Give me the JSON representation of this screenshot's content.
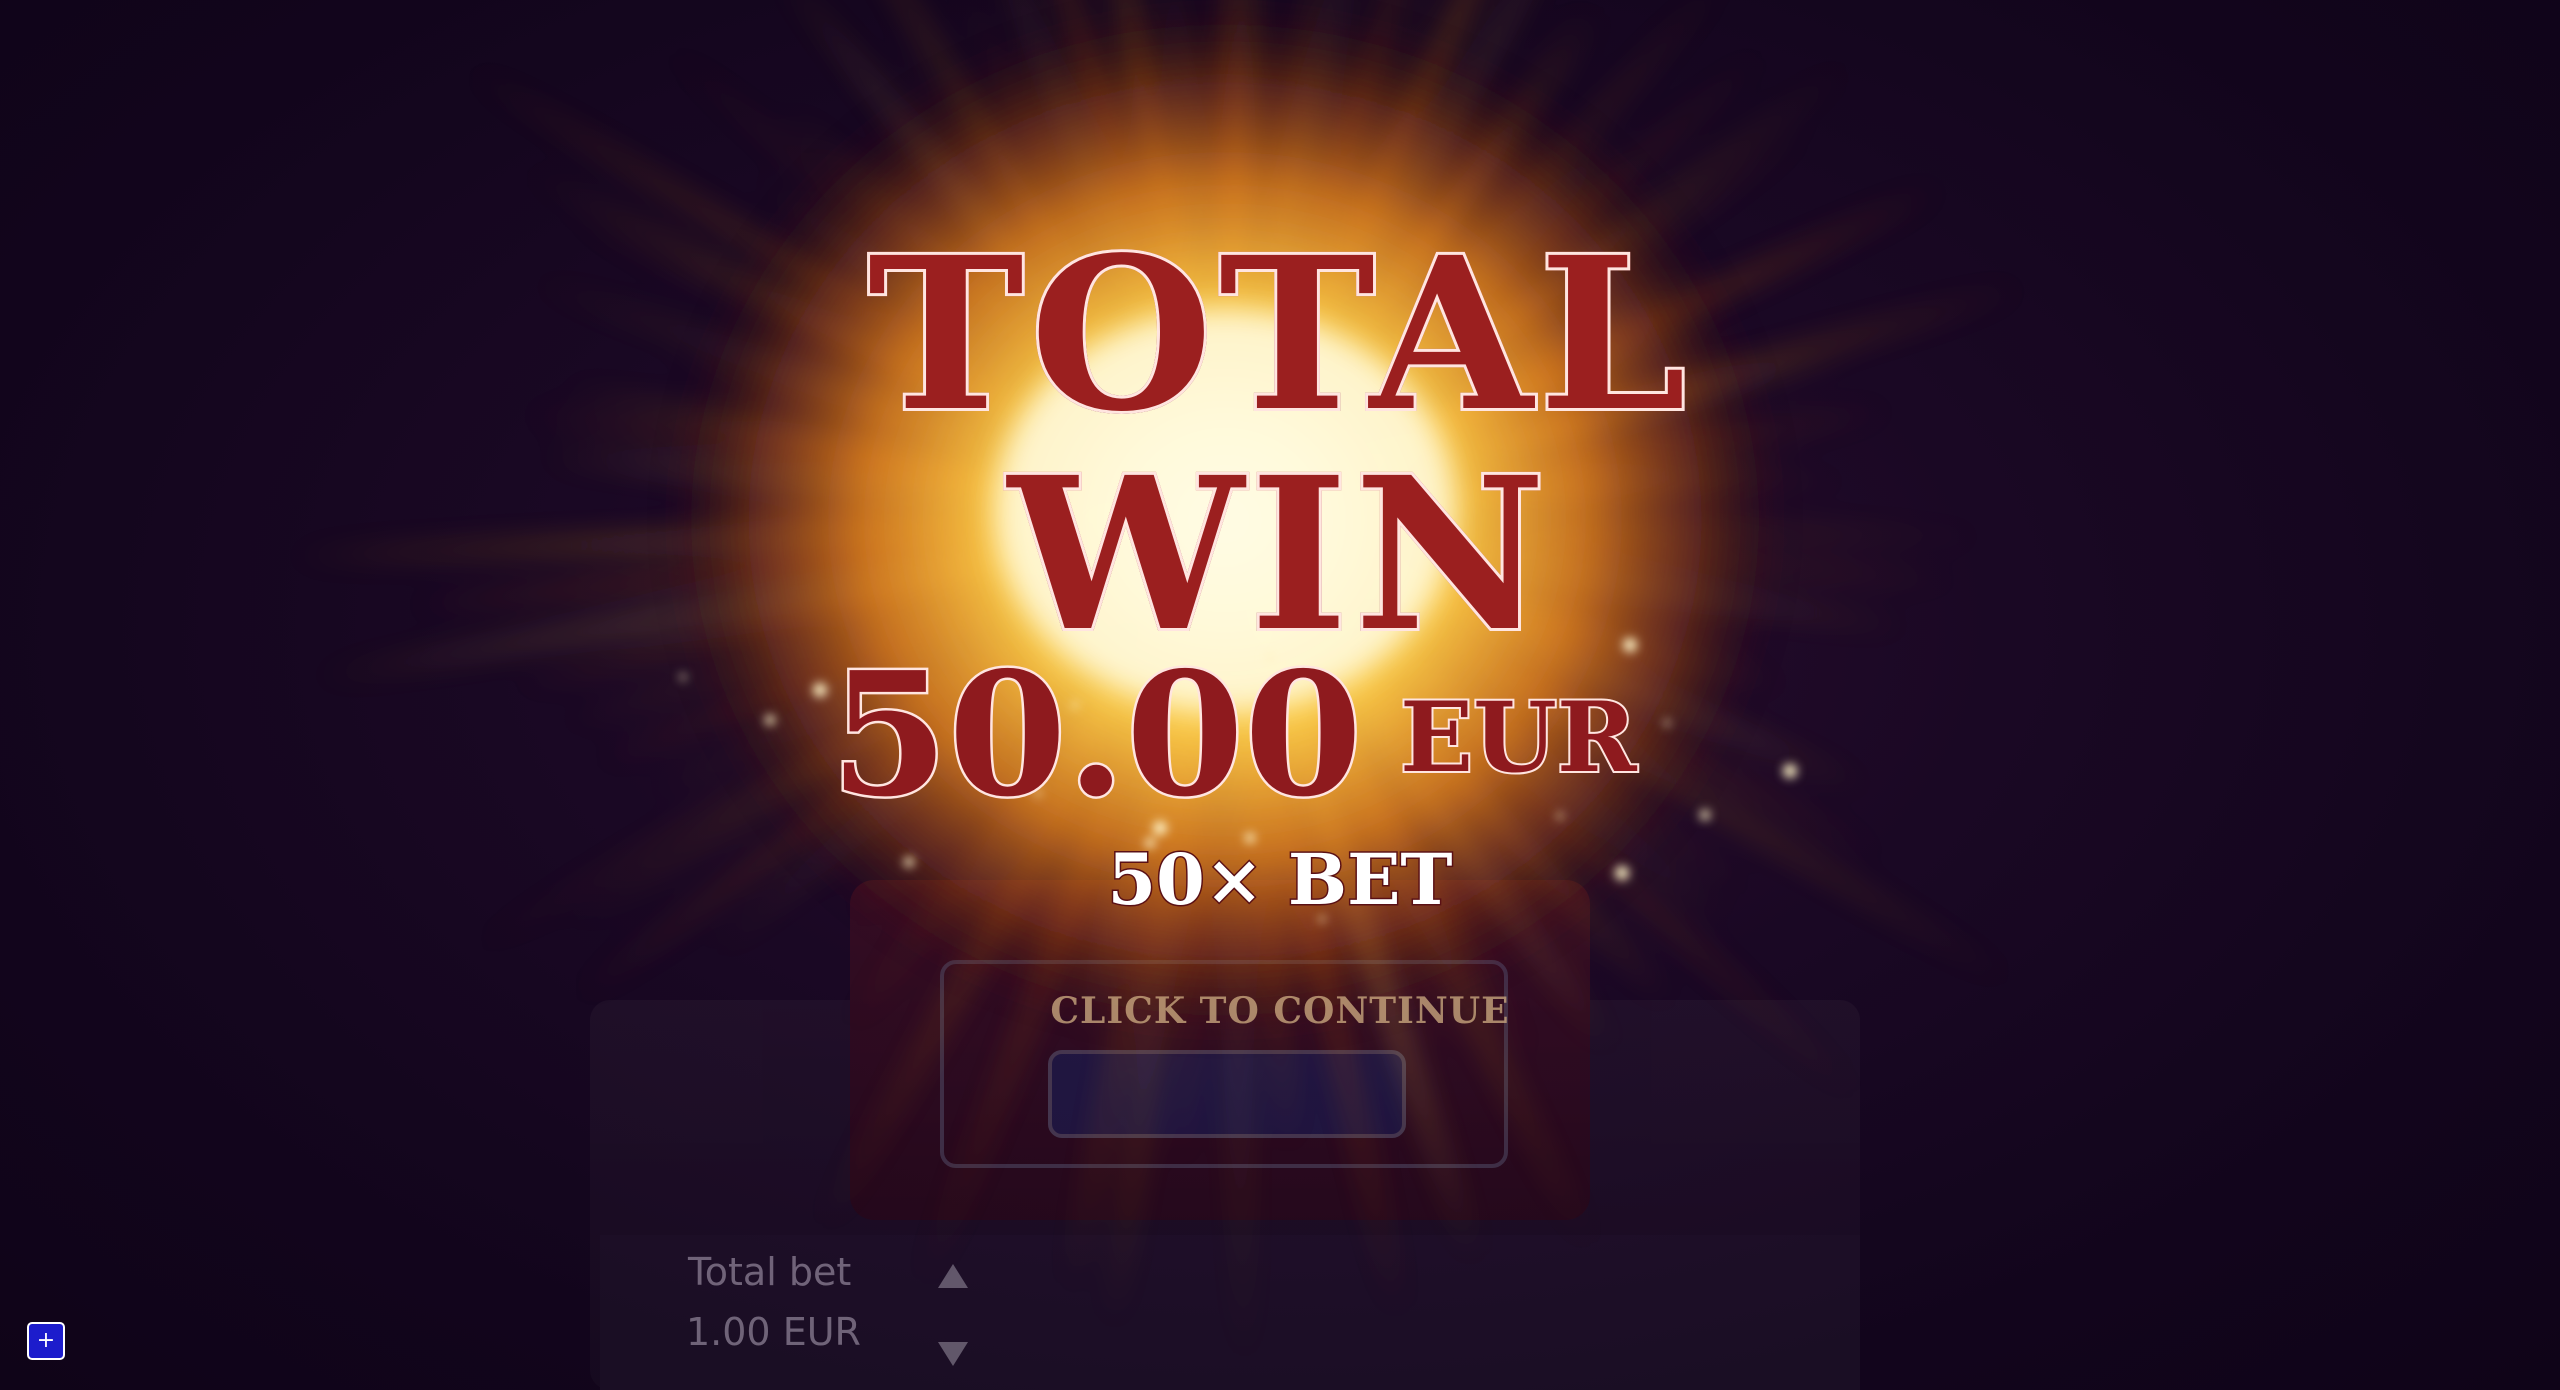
{
  "win_popup": {
    "title_line1": "TOTAL",
    "title_line2": "WIN",
    "amount": "50.00",
    "currency": "EUR",
    "multiplier_text": "50× BET",
    "continue_text": "CLICK TO CONTINUE"
  },
  "bet_panel": {
    "label": "Total bet",
    "value": "1.00 EUR"
  },
  "fullscreen_button": {
    "icon": "plus-icon",
    "symbol": "+"
  },
  "colors": {
    "background": "#14061f",
    "title_red": "#8e1a1e",
    "outline": "#ffe5e0",
    "burst_core": "#fff6c0",
    "burst_orange": "#f08a1c",
    "button_blue": "#1c1ccc"
  }
}
